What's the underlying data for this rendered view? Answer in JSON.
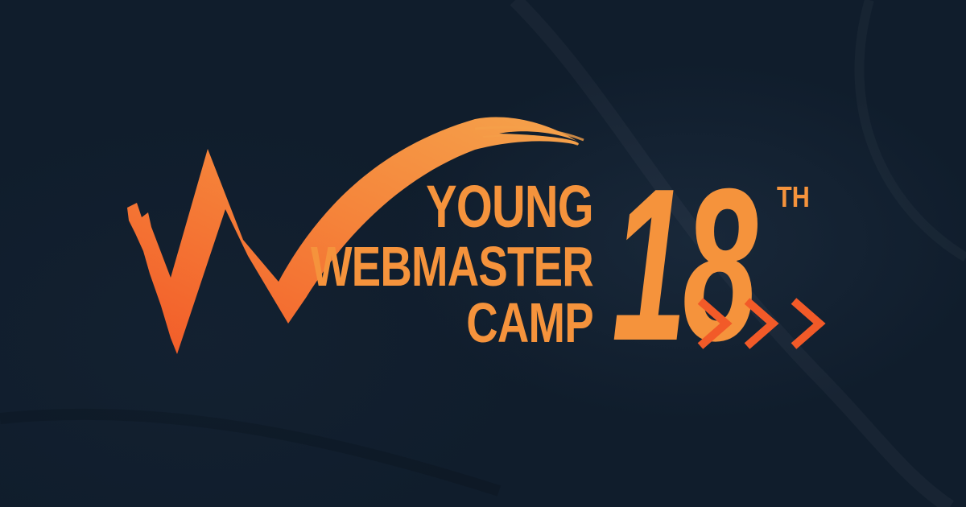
{
  "brand": {
    "line1": "YOUNG",
    "line2": "WEBMASTER",
    "line3": "CAMP"
  },
  "edition": {
    "number": "18",
    "suffix": "TH"
  },
  "icons": {
    "logo": "w-swoosh-logo-icon",
    "arrows": "triple-chevron-right-icon"
  },
  "colors": {
    "background": "#101d2c",
    "accent_orange": "#f5933c",
    "accent_red_orange": "#f05a28"
  }
}
